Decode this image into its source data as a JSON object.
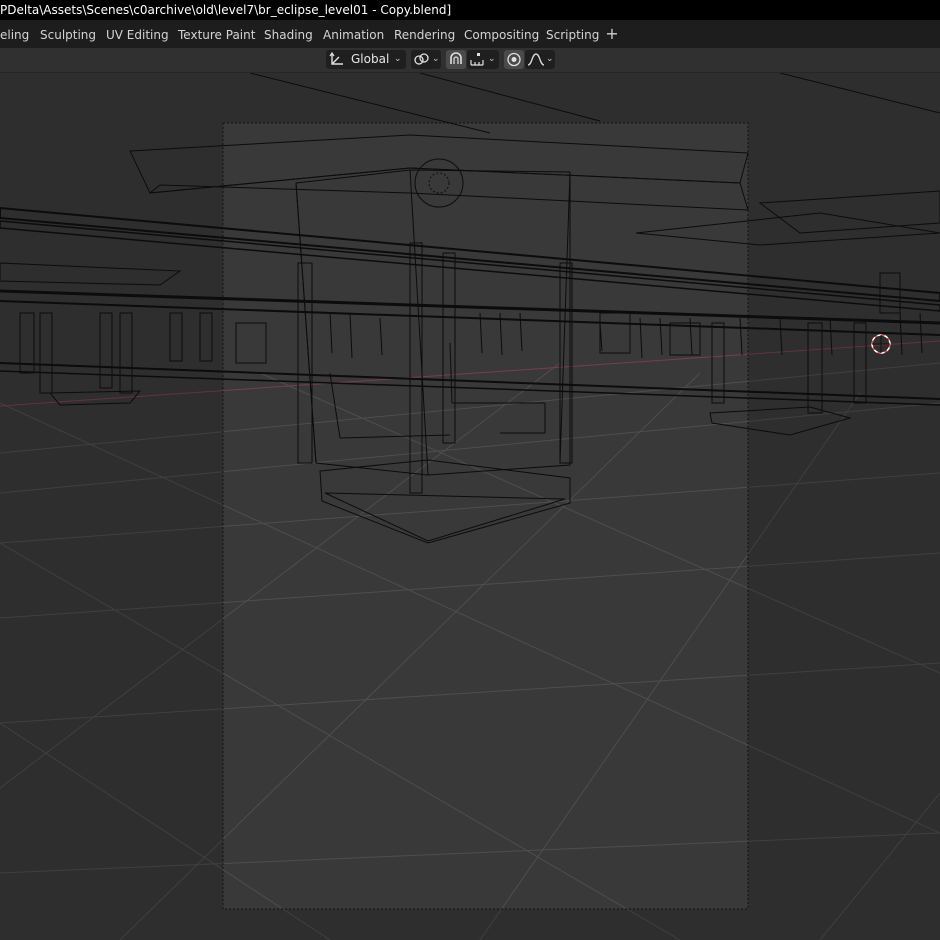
{
  "window": {
    "title": "PDelta\\Assets\\Scenes\\c0archive\\old\\level7\\br_eclipse_level01 - Copy.blend]"
  },
  "workspaces": {
    "tabs": [
      {
        "label": "eling"
      },
      {
        "label": "Sculpting"
      },
      {
        "label": "UV Editing"
      },
      {
        "label": "Texture Paint"
      },
      {
        "label": "Shading"
      },
      {
        "label": "Animation"
      },
      {
        "label": "Rendering"
      },
      {
        "label": "Compositing"
      },
      {
        "label": "Scripting"
      }
    ],
    "add_label": "+"
  },
  "header": {
    "transform_orientation": "Global",
    "icons": [
      "transform-orientation-icon",
      "pivot-point-icon",
      "snap-icon",
      "snap-increment-icon",
      "proportional-editing-icon",
      "falloff-icon"
    ]
  },
  "colors": {
    "titlebar_bg": "#000000",
    "tabbar_bg": "#1d1d1d",
    "header_bg": "#303030",
    "viewport_bg": "#393939",
    "wire": "#0e0e0e",
    "grid": "#4a4a4a",
    "x_axis": "#7a3f48",
    "cursor": "#e05050"
  }
}
